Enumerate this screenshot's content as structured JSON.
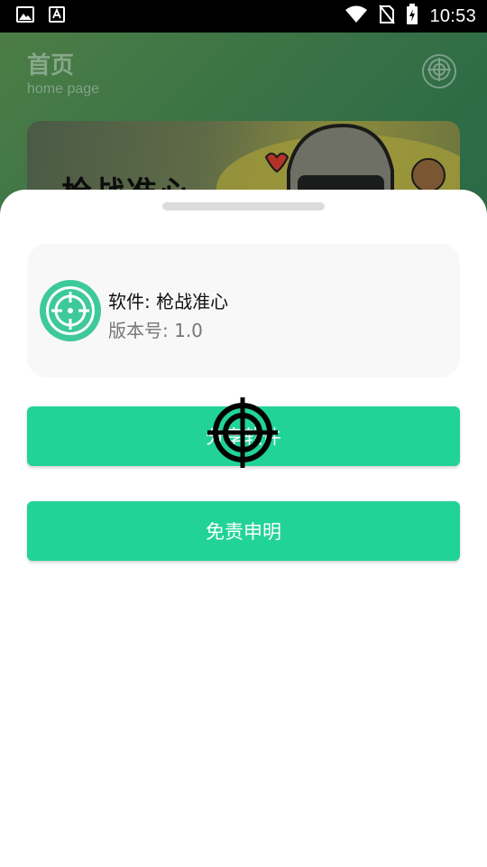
{
  "status_bar": {
    "time": "10:53",
    "icons": [
      "image-icon",
      "font-icon",
      "wifi-icon",
      "no-sim-icon",
      "battery-charging-icon"
    ]
  },
  "background_page": {
    "title": "首页",
    "subtitle": "home page",
    "banner_text": "枪战准心"
  },
  "sheet": {
    "app_name": "软件: 枪战准心",
    "app_version": "版本号: 1.0",
    "share_button": "分享软件",
    "disclaimer_button": "免责申明"
  },
  "colors": {
    "accent": "#22d397",
    "card_bg": "#f8f8f8",
    "status_bar": "#000000"
  }
}
